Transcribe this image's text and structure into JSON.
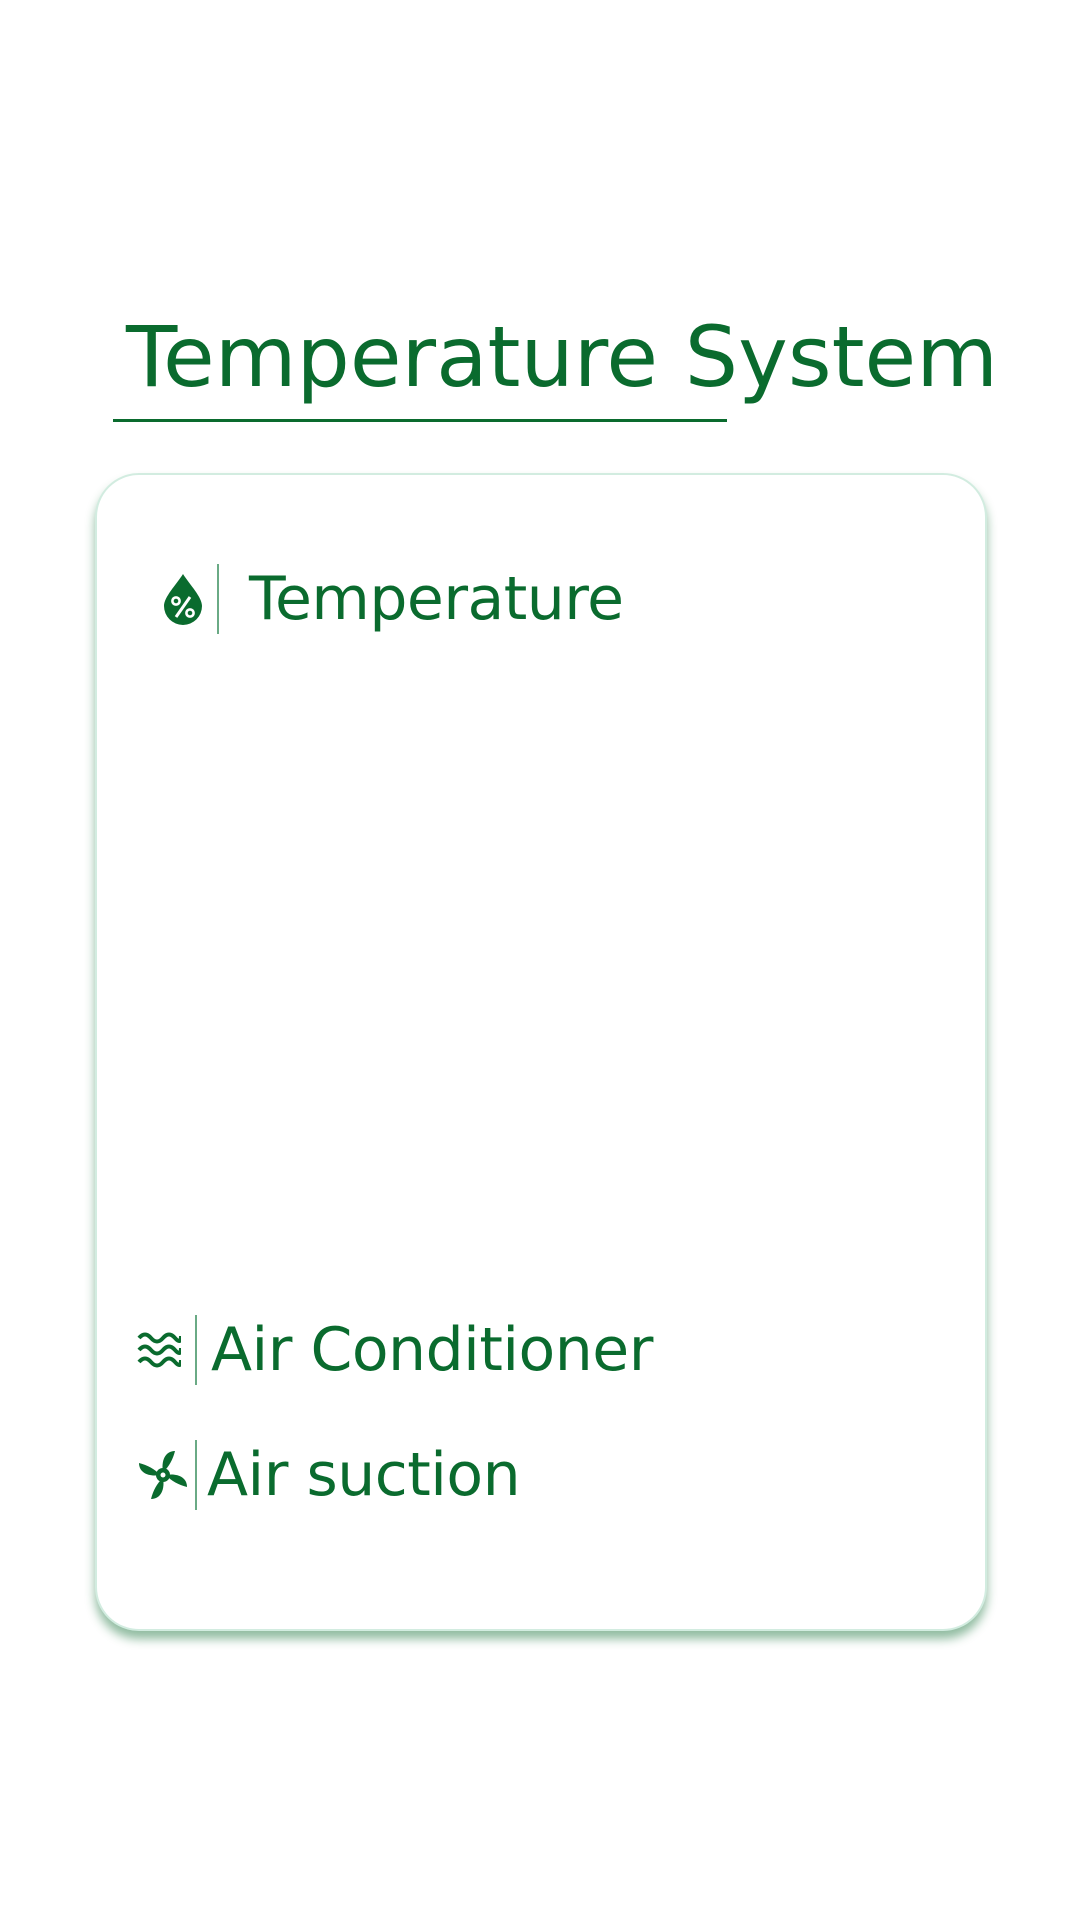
{
  "header": {
    "title": "Temperature System"
  },
  "card": {
    "items": [
      {
        "label": "Temperature",
        "icon": "humidity-drop-icon"
      },
      {
        "label": "Air Conditioner",
        "icon": "air-waves-icon"
      },
      {
        "label": "Air suction",
        "icon": "fan-icon"
      }
    ]
  },
  "colors": {
    "accent": "#0a6b2e",
    "card_border": "#d2ece0",
    "background": "#ffffff"
  }
}
